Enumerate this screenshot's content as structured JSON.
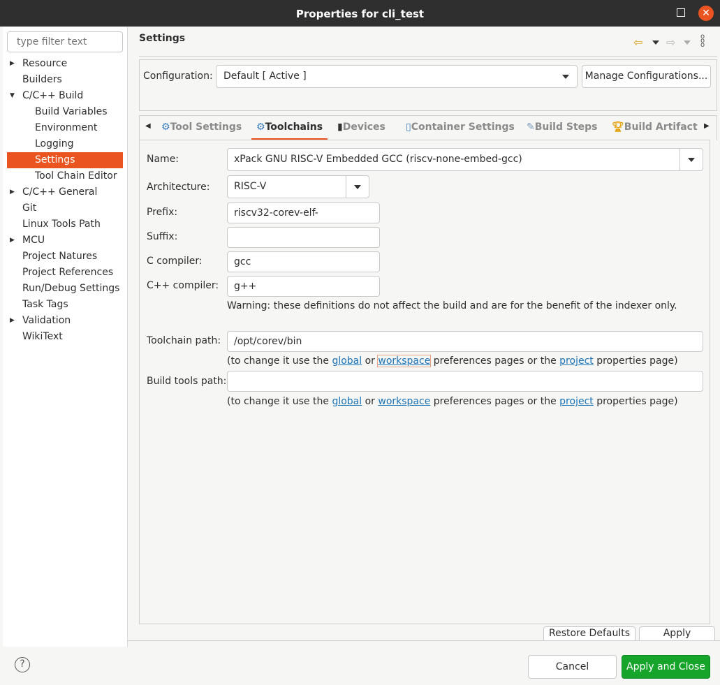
{
  "window": {
    "title": "Properties for cli_test"
  },
  "sidebar": {
    "filter_placeholder": "type filter text",
    "items": [
      {
        "label": "Resource",
        "expandable": true,
        "level": 0
      },
      {
        "label": "Builders",
        "level": 0
      },
      {
        "label": "C/C++ Build",
        "expanded": true,
        "level": 0
      },
      {
        "label": "Build Variables",
        "level": 1
      },
      {
        "label": "Environment",
        "level": 1
      },
      {
        "label": "Logging",
        "level": 1
      },
      {
        "label": "Settings",
        "level": 1,
        "selected": true
      },
      {
        "label": "Tool Chain Editor",
        "level": 1
      },
      {
        "label": "C/C++ General",
        "expandable": true,
        "level": 0
      },
      {
        "label": "Git",
        "level": 0
      },
      {
        "label": "Linux Tools Path",
        "level": 0
      },
      {
        "label": "MCU",
        "expandable": true,
        "level": 0
      },
      {
        "label": "Project Natures",
        "level": 0
      },
      {
        "label": "Project References",
        "level": 0
      },
      {
        "label": "Run/Debug Settings",
        "level": 0
      },
      {
        "label": "Task Tags",
        "level": 0
      },
      {
        "label": "Validation",
        "expandable": true,
        "level": 0
      },
      {
        "label": "WikiText",
        "level": 0
      }
    ]
  },
  "header": {
    "title": "Settings"
  },
  "config": {
    "label": "Configuration:",
    "value": "Default  [ Active ]",
    "manage_label": "Manage Configurations..."
  },
  "tabs": [
    {
      "label": "Tool Settings"
    },
    {
      "label": "Toolchains",
      "active": true
    },
    {
      "label": "Devices"
    },
    {
      "label": "Container Settings"
    },
    {
      "label": "Build Steps"
    },
    {
      "label": "Build Artifact"
    }
  ],
  "form": {
    "name_label": "Name:",
    "name_value": "xPack GNU RISC-V Embedded GCC (riscv-none-embed-gcc)",
    "arch_label": "Architecture:",
    "arch_value": "RISC-V",
    "prefix_label": "Prefix:",
    "prefix_value": "riscv32-corev-elf-",
    "suffix_label": "Suffix:",
    "suffix_value": "",
    "c_label": "C compiler:",
    "c_value": "gcc",
    "cpp_label": "C++ compiler:",
    "cpp_value": "g++",
    "warning": "Warning: these definitions do not affect the build and are for the benefit of the indexer only.",
    "toolchain_path_label": "Toolchain path:",
    "toolchain_path_value": "/opt/corev/bin",
    "build_tools_label": "Build tools path:",
    "build_tools_value": "",
    "note_pre": "(to change it use the ",
    "note_global": "global",
    "note_or": " or ",
    "note_workspace": "workspace",
    "note_mid": " preferences pages or the ",
    "note_project": "project",
    "note_post": " properties page)"
  },
  "buttons": {
    "restore": "Restore Defaults",
    "apply": "Apply",
    "cancel": "Cancel",
    "apply_close": "Apply and Close"
  },
  "colors": {
    "accent": "#e95420",
    "primary": "#17a42b",
    "link": "#1a73b5"
  }
}
